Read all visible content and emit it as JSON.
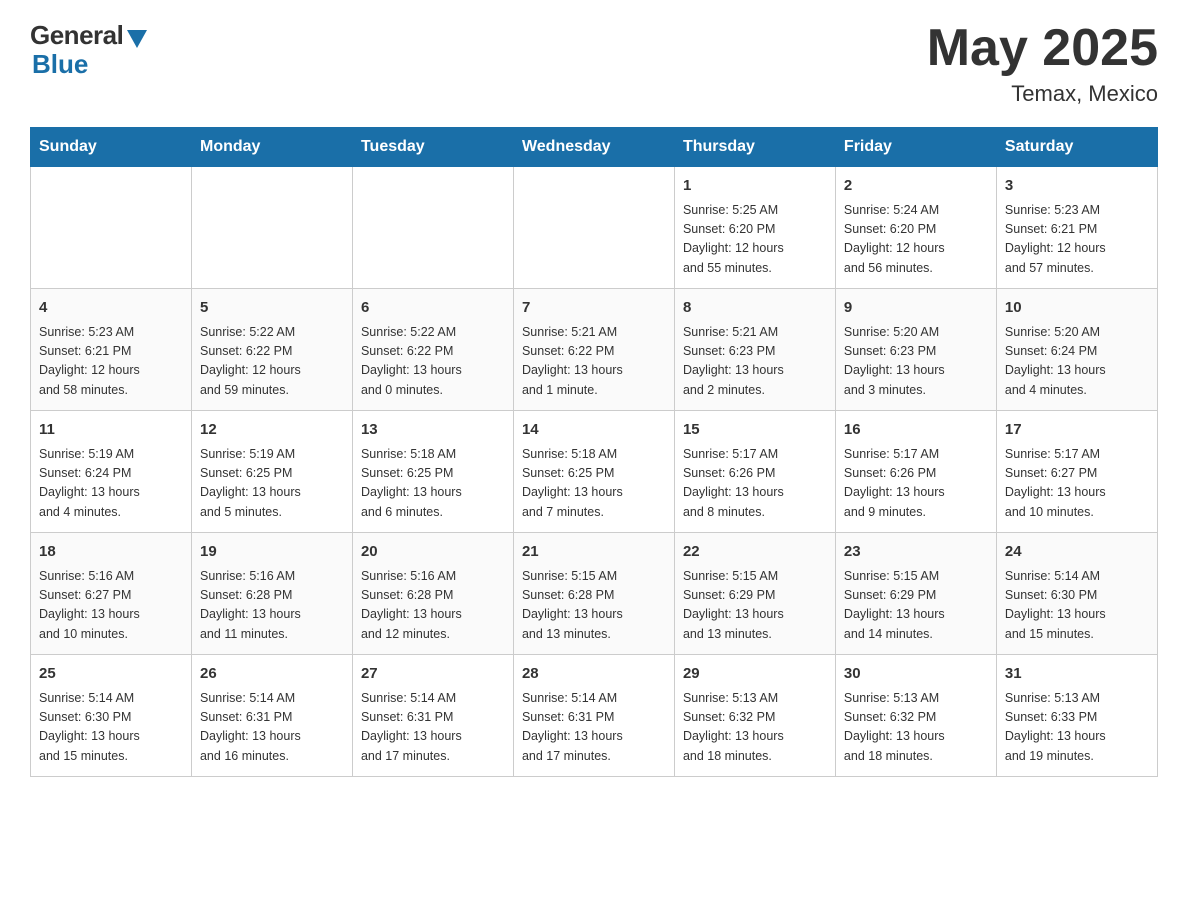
{
  "header": {
    "logo": {
      "general": "General",
      "blue": "Blue"
    },
    "month_year": "May 2025",
    "location": "Temax, Mexico"
  },
  "days_of_week": [
    "Sunday",
    "Monday",
    "Tuesday",
    "Wednesday",
    "Thursday",
    "Friday",
    "Saturday"
  ],
  "weeks": [
    [
      {
        "day": "",
        "info": ""
      },
      {
        "day": "",
        "info": ""
      },
      {
        "day": "",
        "info": ""
      },
      {
        "day": "",
        "info": ""
      },
      {
        "day": "1",
        "info": "Sunrise: 5:25 AM\nSunset: 6:20 PM\nDaylight: 12 hours\nand 55 minutes."
      },
      {
        "day": "2",
        "info": "Sunrise: 5:24 AM\nSunset: 6:20 PM\nDaylight: 12 hours\nand 56 minutes."
      },
      {
        "day": "3",
        "info": "Sunrise: 5:23 AM\nSunset: 6:21 PM\nDaylight: 12 hours\nand 57 minutes."
      }
    ],
    [
      {
        "day": "4",
        "info": "Sunrise: 5:23 AM\nSunset: 6:21 PM\nDaylight: 12 hours\nand 58 minutes."
      },
      {
        "day": "5",
        "info": "Sunrise: 5:22 AM\nSunset: 6:22 PM\nDaylight: 12 hours\nand 59 minutes."
      },
      {
        "day": "6",
        "info": "Sunrise: 5:22 AM\nSunset: 6:22 PM\nDaylight: 13 hours\nand 0 minutes."
      },
      {
        "day": "7",
        "info": "Sunrise: 5:21 AM\nSunset: 6:22 PM\nDaylight: 13 hours\nand 1 minute."
      },
      {
        "day": "8",
        "info": "Sunrise: 5:21 AM\nSunset: 6:23 PM\nDaylight: 13 hours\nand 2 minutes."
      },
      {
        "day": "9",
        "info": "Sunrise: 5:20 AM\nSunset: 6:23 PM\nDaylight: 13 hours\nand 3 minutes."
      },
      {
        "day": "10",
        "info": "Sunrise: 5:20 AM\nSunset: 6:24 PM\nDaylight: 13 hours\nand 4 minutes."
      }
    ],
    [
      {
        "day": "11",
        "info": "Sunrise: 5:19 AM\nSunset: 6:24 PM\nDaylight: 13 hours\nand 4 minutes."
      },
      {
        "day": "12",
        "info": "Sunrise: 5:19 AM\nSunset: 6:25 PM\nDaylight: 13 hours\nand 5 minutes."
      },
      {
        "day": "13",
        "info": "Sunrise: 5:18 AM\nSunset: 6:25 PM\nDaylight: 13 hours\nand 6 minutes."
      },
      {
        "day": "14",
        "info": "Sunrise: 5:18 AM\nSunset: 6:25 PM\nDaylight: 13 hours\nand 7 minutes."
      },
      {
        "day": "15",
        "info": "Sunrise: 5:17 AM\nSunset: 6:26 PM\nDaylight: 13 hours\nand 8 minutes."
      },
      {
        "day": "16",
        "info": "Sunrise: 5:17 AM\nSunset: 6:26 PM\nDaylight: 13 hours\nand 9 minutes."
      },
      {
        "day": "17",
        "info": "Sunrise: 5:17 AM\nSunset: 6:27 PM\nDaylight: 13 hours\nand 10 minutes."
      }
    ],
    [
      {
        "day": "18",
        "info": "Sunrise: 5:16 AM\nSunset: 6:27 PM\nDaylight: 13 hours\nand 10 minutes."
      },
      {
        "day": "19",
        "info": "Sunrise: 5:16 AM\nSunset: 6:28 PM\nDaylight: 13 hours\nand 11 minutes."
      },
      {
        "day": "20",
        "info": "Sunrise: 5:16 AM\nSunset: 6:28 PM\nDaylight: 13 hours\nand 12 minutes."
      },
      {
        "day": "21",
        "info": "Sunrise: 5:15 AM\nSunset: 6:28 PM\nDaylight: 13 hours\nand 13 minutes."
      },
      {
        "day": "22",
        "info": "Sunrise: 5:15 AM\nSunset: 6:29 PM\nDaylight: 13 hours\nand 13 minutes."
      },
      {
        "day": "23",
        "info": "Sunrise: 5:15 AM\nSunset: 6:29 PM\nDaylight: 13 hours\nand 14 minutes."
      },
      {
        "day": "24",
        "info": "Sunrise: 5:14 AM\nSunset: 6:30 PM\nDaylight: 13 hours\nand 15 minutes."
      }
    ],
    [
      {
        "day": "25",
        "info": "Sunrise: 5:14 AM\nSunset: 6:30 PM\nDaylight: 13 hours\nand 15 minutes."
      },
      {
        "day": "26",
        "info": "Sunrise: 5:14 AM\nSunset: 6:31 PM\nDaylight: 13 hours\nand 16 minutes."
      },
      {
        "day": "27",
        "info": "Sunrise: 5:14 AM\nSunset: 6:31 PM\nDaylight: 13 hours\nand 17 minutes."
      },
      {
        "day": "28",
        "info": "Sunrise: 5:14 AM\nSunset: 6:31 PM\nDaylight: 13 hours\nand 17 minutes."
      },
      {
        "day": "29",
        "info": "Sunrise: 5:13 AM\nSunset: 6:32 PM\nDaylight: 13 hours\nand 18 minutes."
      },
      {
        "day": "30",
        "info": "Sunrise: 5:13 AM\nSunset: 6:32 PM\nDaylight: 13 hours\nand 18 minutes."
      },
      {
        "day": "31",
        "info": "Sunrise: 5:13 AM\nSunset: 6:33 PM\nDaylight: 13 hours\nand 19 minutes."
      }
    ]
  ]
}
